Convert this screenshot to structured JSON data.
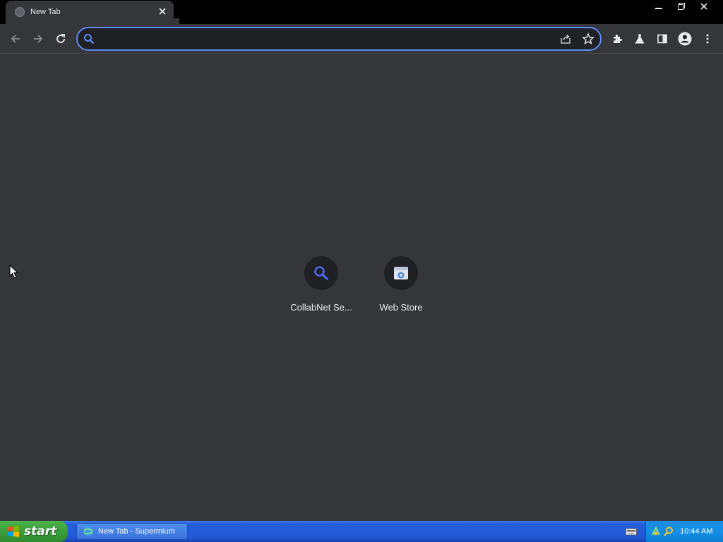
{
  "tab": {
    "title": "New Tab",
    "favicon": "globe-icon",
    "close_icon": "close-icon"
  },
  "window_controls": [
    "minimize-icon",
    "restore-icon",
    "close-icon"
  ],
  "toolbar": {
    "icons": [
      "back-arrow-icon",
      "forward-arrow-icon",
      "reload-icon",
      "extensions-icon",
      "labs-icon",
      "side-panel-icon",
      "profile-icon",
      "menu-icon"
    ]
  },
  "omnibox": {
    "value": "",
    "placeholder": "",
    "accent_color": "#5e8bf5"
  },
  "shortcuts": [
    {
      "label": "CollabNet Se...",
      "icon": "search-icon"
    },
    {
      "label": "Web Store",
      "icon": "web-store-icon"
    }
  ],
  "taskbar": {
    "start_label": "start",
    "tasks": [
      {
        "label": "New Tab - Supermium",
        "icon": "browser-icon"
      }
    ],
    "clock": "10:44 AM"
  },
  "colors": {
    "background": "#35363a",
    "titlebar": "#000000",
    "taskbar_blue": "#245edb",
    "start_green": "#3a9d3a"
  }
}
